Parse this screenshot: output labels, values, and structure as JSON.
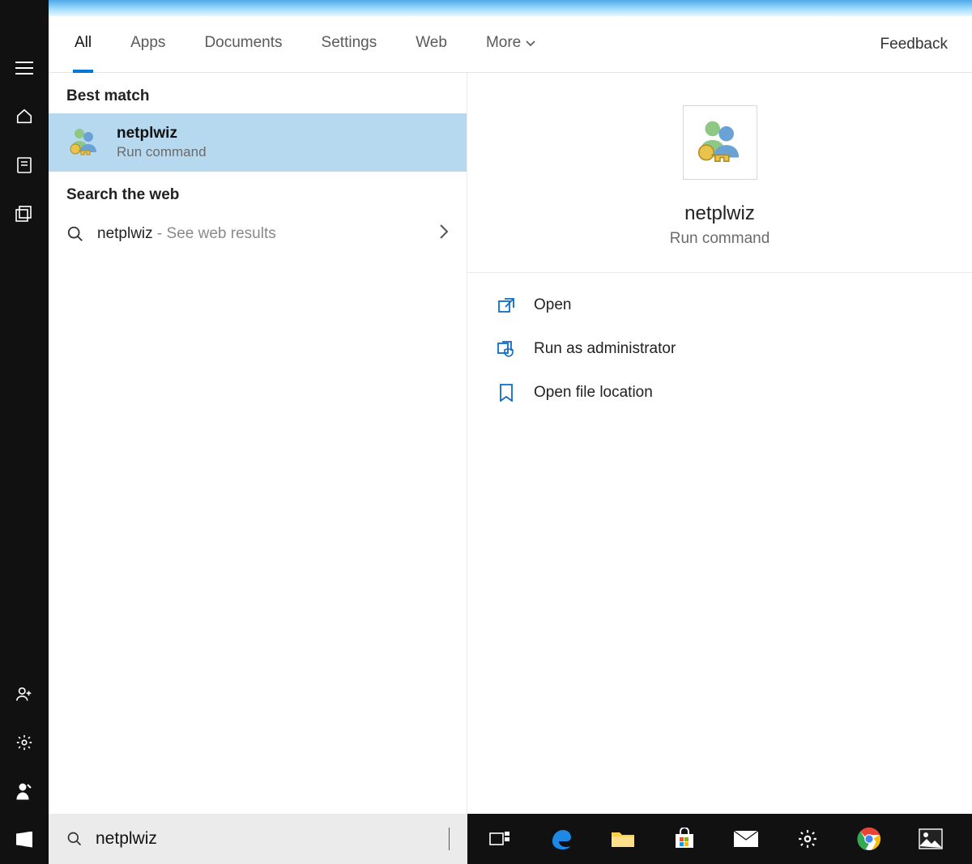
{
  "tabs": {
    "all": "All",
    "apps": "Apps",
    "documents": "Documents",
    "settings": "Settings",
    "web": "Web",
    "more": "More"
  },
  "feedback_label": "Feedback",
  "sections": {
    "best_match": "Best match",
    "search_web": "Search the web"
  },
  "best_match": {
    "title": "netplwiz",
    "subtitle": "Run command"
  },
  "web_result": {
    "term": "netplwiz",
    "suffix": " - See web results"
  },
  "preview": {
    "title": "netplwiz",
    "subtitle": "Run command"
  },
  "actions": {
    "open": "Open",
    "run_admin": "Run as administrator",
    "open_location": "Open file location"
  },
  "search_value": "netplwiz",
  "rail": {
    "menu": "menu",
    "home": "home",
    "recent": "recent",
    "collections": "collections",
    "add_user": "add-user",
    "settings": "settings",
    "profile": "profile",
    "start": "start"
  },
  "taskbar": {
    "taskview": "task-view",
    "edge": "edge",
    "explorer": "file-explorer",
    "store": "store",
    "mail": "mail",
    "settings": "settings",
    "chrome": "chrome",
    "photos": "photos"
  }
}
